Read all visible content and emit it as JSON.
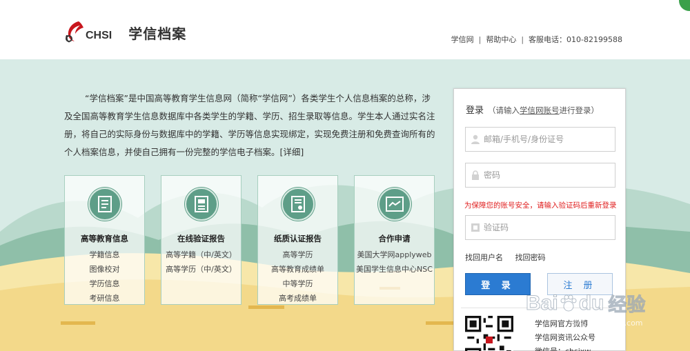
{
  "header": {
    "logo_text": "CHSI",
    "site_title": "学信档案",
    "links": [
      "学信网",
      "帮助中心",
      "客服电话：010-82199588"
    ]
  },
  "intro": {
    "text": "“学信档案”是中国高等教育学生信息网（简称“学信网”）各类学生个人信息档案的总称，涉及全国高等教育学生信息数据库中各类学生的学籍、学历、招生录取等信息。学生本人通过实名注册，将自己的实际身份与数据库中的学籍、学历等信息实现绑定，实现免费注册和免费查询所有的个人档案信息，并使自己拥有一份完整的学信电子档案。",
    "more_label": "[详细]"
  },
  "cards": [
    {
      "title": "高等教育信息",
      "icon": "document-icon",
      "items": [
        "学籍信息",
        "图像校对",
        "学历信息",
        "考研信息"
      ]
    },
    {
      "title": "在线验证报告",
      "icon": "report-icon",
      "items": [
        "高等学籍（中/英文）",
        "高等学历（中/英文）"
      ]
    },
    {
      "title": "纸质认证报告",
      "icon": "paper-certificate-icon",
      "items": [
        "高等学历",
        "高等教育成绩单",
        "中等学历",
        "高考成绩单"
      ]
    },
    {
      "title": "合作申请",
      "icon": "handshake-icon",
      "items": [
        "美国大学网applyweb",
        "美国学生信息中心NSC"
      ]
    }
  ],
  "login": {
    "title": "登录",
    "hint_prefix": "（请输入",
    "hint_link": "学信网账号",
    "hint_suffix": "进行登录）",
    "username_placeholder": "邮箱/手机号/身份证号",
    "password_placeholder": "密码",
    "warning": "为保障您的账号安全，请输入验证码后重新登录",
    "captcha_placeholder": "验证码",
    "find_username": "找回用户名",
    "find_password": "找回密码",
    "login_button": "登 录",
    "register_button": "注 册",
    "wechat_lines": [
      "学信网官方微博",
      "学信网资讯公众号",
      "微信号：chsixw"
    ]
  },
  "watermark": {
    "text": "Bai",
    "text2": "du",
    "cn": "经验",
    "sub": "jingyan.baidu.com"
  },
  "colors": {
    "banner_bg": "#d8ebe6",
    "card_icon": "#5e9e88",
    "login_button": "#2b7bd2",
    "warning": "#e02020"
  }
}
